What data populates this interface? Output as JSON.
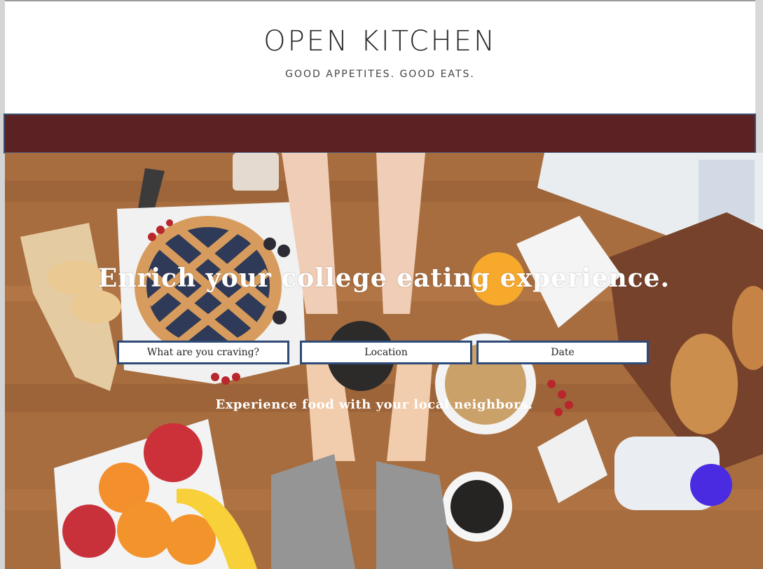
{
  "site": {
    "brand": "OPEN KITCHEN",
    "tagline": "GOOD APPETITES. GOOD EATS."
  },
  "navbar": {
    "color": "#5c2123"
  },
  "hero": {
    "headline": "Enrich your college eating experience.",
    "subtext": "Experience food with your local neighbors."
  },
  "search": {
    "craving_placeholder": "What are you craving?",
    "location_placeholder": "Location",
    "date_placeholder": "Date"
  }
}
